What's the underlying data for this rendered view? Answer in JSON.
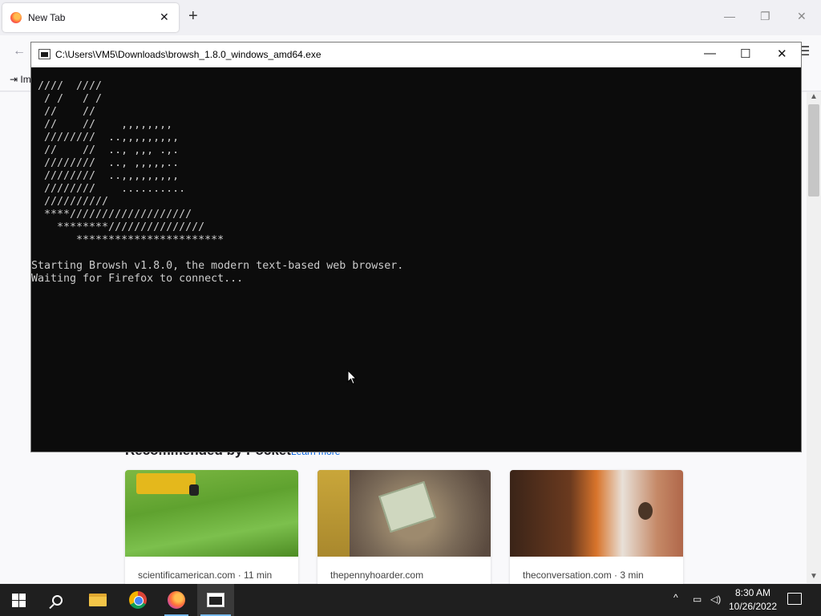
{
  "firefox": {
    "tab_title": "New Tab",
    "tab_close": "✕",
    "new_tab": "+",
    "window_controls": {
      "minimize": "—",
      "restore": "❐",
      "close": "✕"
    },
    "back": "←",
    "menu": "☰",
    "bookmarks": {
      "import_label": "⇥ Im"
    },
    "pocket": {
      "heading": "Recommended by Pocket",
      "learn_more": "Learn more",
      "cards": [
        {
          "source": "scientificamerican.com · 11 min",
          "image": "lawn-mower-grass"
        },
        {
          "source": "thepennyhoarder.com",
          "image": "crumpled-dollar-bill"
        },
        {
          "source": "theconversation.com · 3 min",
          "image": "spider-on-door"
        }
      ]
    }
  },
  "console": {
    "title": "C:\\Users\\VM5\\Downloads\\browsh_1.8.0_windows_amd64.exe",
    "controls": {
      "minimize": "—",
      "maximize": "☐",
      "close": "✕"
    },
    "ascii_art": "////  ////\n / /   / /\n //    //\n //    //    ,,,,,,,,\n ////////  ..,,,,,,,,,\n //    //  .., ,,, .,.\n ////////  .., ,,,,,..\n ////////  ..,,,,,,,,,\n ////////    ..........\n //////////\n ****///////////////////\n   ********///////////////\n      ***********************",
    "output": "Starting Browsh v1.8.0, the modern text-based web browser.\nWaiting for Firefox to connect..."
  },
  "taskbar": {
    "items": [
      "start-icon",
      "search-icon",
      "file-explorer-icon",
      "chrome-icon",
      "firefox-icon",
      "console-icon"
    ],
    "tray": {
      "chevron": "^",
      "network": "▭",
      "volume": "◁)"
    },
    "time": "8:30 AM",
    "date": "10/26/2022"
  }
}
